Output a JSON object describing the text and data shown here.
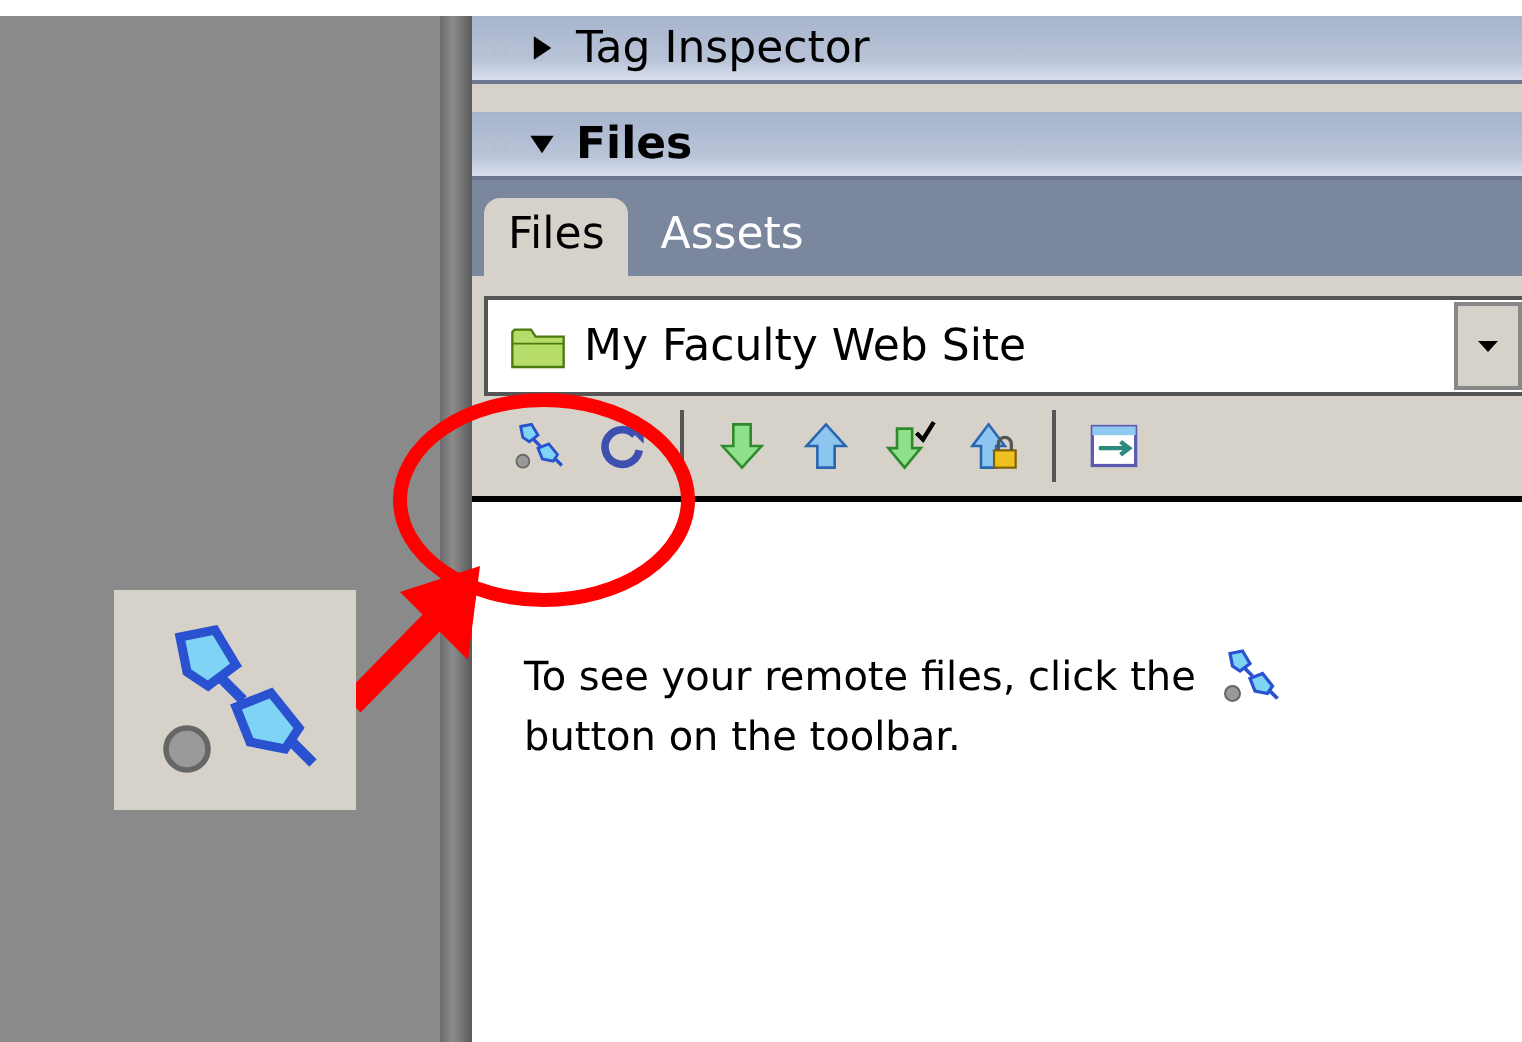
{
  "panels": [
    {
      "title": "Tag Inspector",
      "expanded": false
    },
    {
      "title": "Files",
      "expanded": true
    }
  ],
  "tabs": [
    {
      "label": "Files",
      "selected": true
    },
    {
      "label": "Assets",
      "selected": false
    }
  ],
  "site_select": {
    "value": "My Faculty Web Site"
  },
  "message": {
    "line_1": "To see your remote files, click the",
    "line_2": "button on the toolbar."
  }
}
